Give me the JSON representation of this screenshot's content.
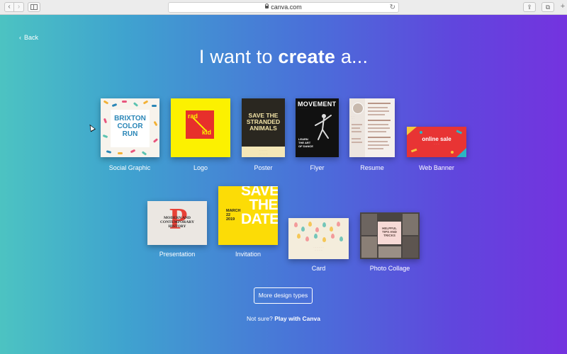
{
  "browser": {
    "url": "canva.com",
    "back_icon": "chevron-left-icon",
    "forward_icon": "chevron-right-icon"
  },
  "page": {
    "back_label": "Back",
    "headline_prefix": "I want to ",
    "headline_bold": "create",
    "headline_suffix": " a..."
  },
  "design_types": [
    {
      "label": "Social Graphic",
      "thumb_lines": [
        "BRIXTON",
        "COLOR RUN"
      ]
    },
    {
      "label": "Logo",
      "thumb_words": [
        "rad",
        "kid"
      ]
    },
    {
      "label": "Poster",
      "thumb_lines": [
        "SAVE THE",
        "STRANDED",
        "ANIMALS"
      ]
    },
    {
      "label": "Flyer",
      "thumb_title": "MOVEMENT",
      "thumb_lines": [
        "LEARN",
        "THE ART",
        "OF DANCE"
      ]
    },
    {
      "label": "Resume"
    },
    {
      "label": "Web Banner",
      "thumb_title": "online sale"
    },
    {
      "label": "Presentation",
      "thumb_lines": [
        "MODERN AND",
        "CONTEMPORARY",
        "HISTORY"
      ]
    },
    {
      "label": "Invitation",
      "thumb_big": [
        "SAVE",
        "THE",
        "DATE"
      ],
      "thumb_date": [
        "MARCH",
        "22",
        "2019"
      ]
    },
    {
      "label": "Card"
    },
    {
      "label": "Photo Collage",
      "thumb_lines": [
        "HELPFUL",
        "TIPS AND",
        "TRICKS"
      ]
    }
  ],
  "more_button": "More design types",
  "footer": {
    "prefix": "Not sure? ",
    "link": "Play with Canva"
  },
  "colors": {
    "gradient_start": "#4cc3c2",
    "gradient_end": "#7433df"
  }
}
